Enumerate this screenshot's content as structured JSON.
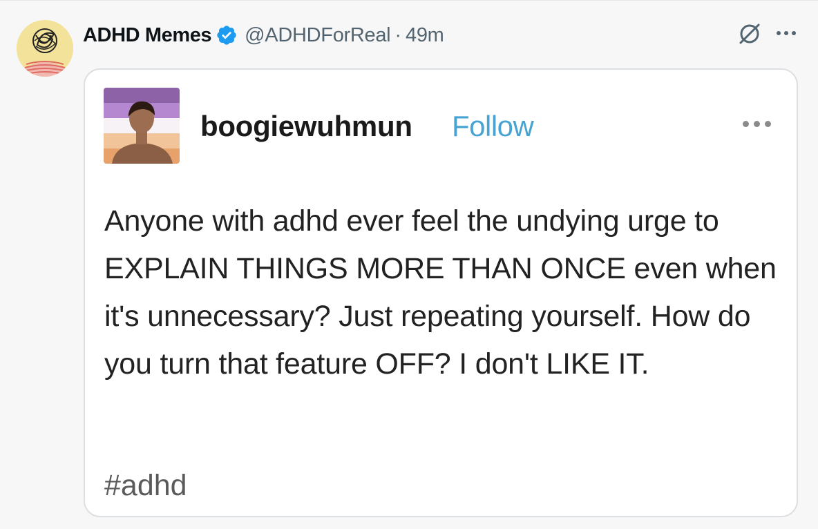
{
  "tweet": {
    "author_name": "ADHD Memes",
    "author_handle": "@ADHDForReal",
    "separator": "·",
    "time": "49m",
    "icons": {
      "verified": "verified-badge-icon",
      "grok": "grok-icon",
      "more": "more-options-icon"
    },
    "colors": {
      "verified": "#1d9bf0",
      "secondary_text": "#536471"
    }
  },
  "embedded_post": {
    "poster_name": "boogiewuhmun",
    "follow_label": "Follow",
    "body": "Anyone with adhd ever feel the undying urge to EXPLAIN THINGS MORE THAN ONCE even when it's unnecessary? Just repeating yourself. How do you turn that feature OFF? I don't LIKE IT.",
    "tag": "#adhd",
    "colors": {
      "follow": "#47a4d2"
    }
  }
}
